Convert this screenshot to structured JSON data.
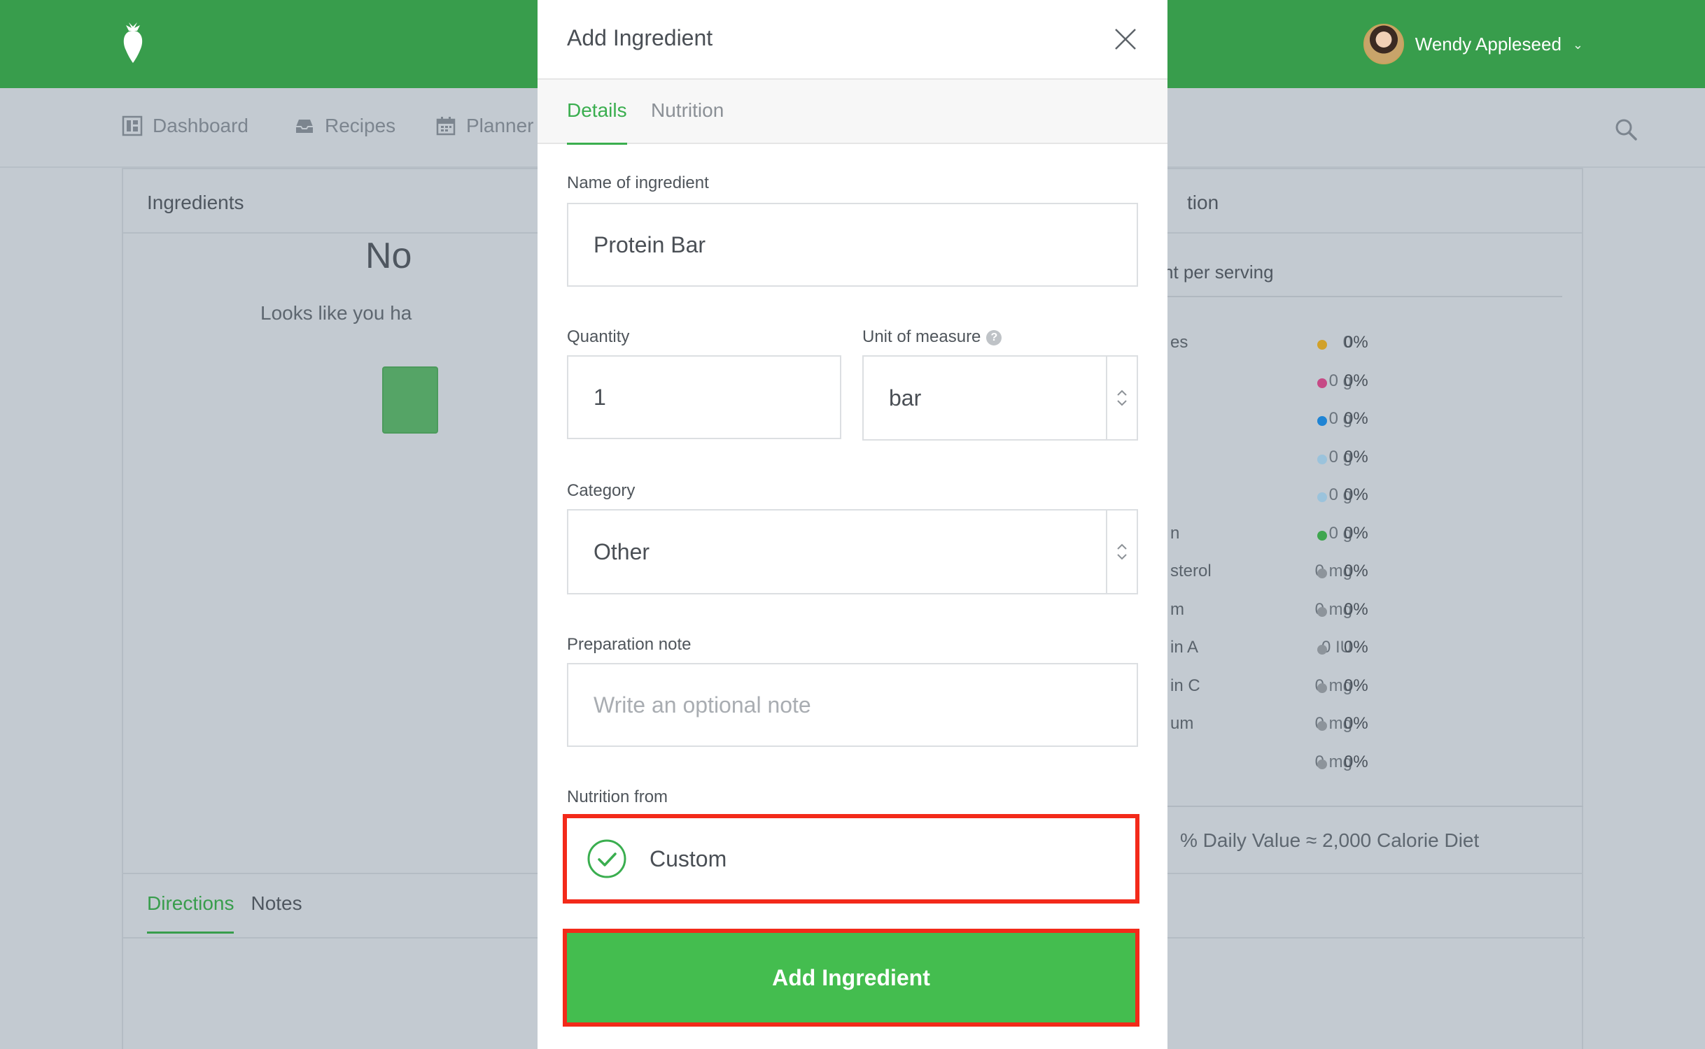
{
  "app": {
    "user_name": "Wendy Appleseed",
    "nav": [
      {
        "label": "Dashboard",
        "icon": "dashboard-icon"
      },
      {
        "label": "Recipes",
        "icon": "inbox-icon"
      },
      {
        "label": "Planner",
        "icon": "calendar-icon"
      }
    ]
  },
  "ingredients_panel": {
    "title": "Ingredients",
    "empty_title": "No",
    "empty_subtitle": "Looks like you ha"
  },
  "nutrition_panel": {
    "title": "tion",
    "subtitle": "nt per serving",
    "rows": [
      {
        "name": "es",
        "amount": "0",
        "pct": "0%",
        "color": "#d1a12a"
      },
      {
        "name": "",
        "amount": "0 g",
        "pct": "0%",
        "color": "#c64a86"
      },
      {
        "name": "",
        "amount": "0 g",
        "pct": "0%",
        "color": "#1f84d4"
      },
      {
        "name": "",
        "amount": "0 g",
        "pct": "0%",
        "color": "#9bc3dc"
      },
      {
        "name": "",
        "amount": "0 g",
        "pct": "0%",
        "color": "#9bc3dc"
      },
      {
        "name": "n",
        "amount": "0 g",
        "pct": "0%",
        "color": "#3fa64f"
      },
      {
        "name": "sterol",
        "amount": "0 mg",
        "pct": "0%",
        "color": "#8d949b"
      },
      {
        "name": "m",
        "amount": "0 mg",
        "pct": "0%",
        "color": "#8d949b"
      },
      {
        "name": "in A",
        "amount": "0 IU",
        "pct": "0%",
        "color": "#8d949b"
      },
      {
        "name": "in C",
        "amount": "0 mg",
        "pct": "0%",
        "color": "#8d949b"
      },
      {
        "name": "um",
        "amount": "0 mg",
        "pct": "0%",
        "color": "#8d949b"
      },
      {
        "name": "",
        "amount": "0 mg",
        "pct": "0%",
        "color": "#8d949b"
      }
    ],
    "footer": "% Daily Value ≈ 2,000 Calorie Diet"
  },
  "directions_panel": {
    "tabs": [
      "Directions",
      "Notes"
    ]
  },
  "modal": {
    "title": "Add Ingredient",
    "tabs": [
      "Details",
      "Nutrition"
    ],
    "name_label": "Name of ingredient",
    "name_value": "Protein Bar",
    "quantity_label": "Quantity",
    "quantity_value": "1",
    "unit_label": "Unit of measure",
    "unit_help": "?",
    "unit_value": "bar",
    "category_label": "Category",
    "category_value": "Other",
    "prep_label": "Preparation note",
    "prep_placeholder": "Write an optional note",
    "nutrition_from_label": "Nutrition from",
    "nutrition_from_value": "Custom",
    "submit_label": "Add Ingredient"
  },
  "colors": {
    "brand_green": "#389d4c",
    "button_green": "#44bd4f",
    "highlight_red": "#f32a1a"
  }
}
